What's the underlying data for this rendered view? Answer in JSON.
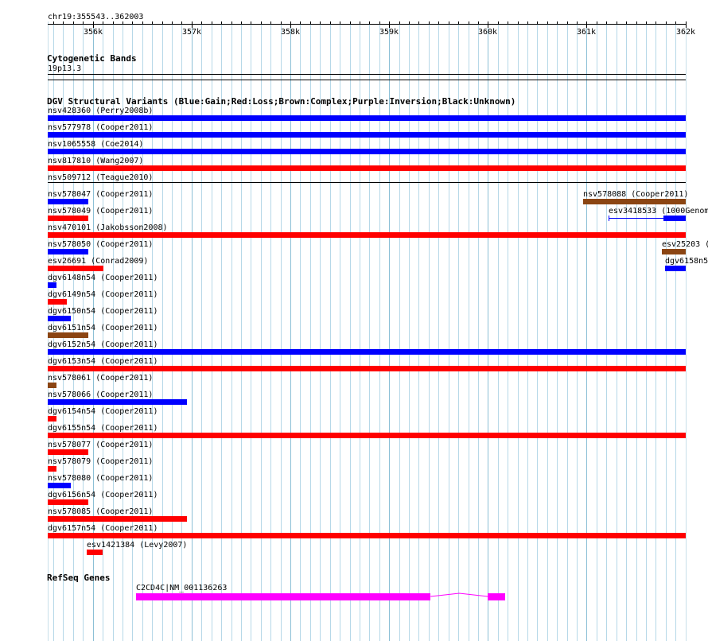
{
  "ruler": {
    "location": "chr19:355543..362003",
    "ticks": [
      "356k",
      "357k",
      "358k",
      "359k",
      "360k",
      "361k",
      "362k"
    ],
    "tick_positions_bp": [
      356000,
      357000,
      358000,
      359000,
      360000,
      361000,
      362000
    ]
  },
  "range": {
    "start": 355543,
    "end": 362003
  },
  "cytoband": {
    "title": "Cytogenetic Bands",
    "band": "19p13.3"
  },
  "dgv": {
    "title": "DGV Structural Variants (Blue:Gain;Red:Loss;Brown:Complex;Purple:Inversion;Black:Unknown)",
    "colors": {
      "gain": "#0000ff",
      "loss": "#ff0000",
      "complex": "#8b4513",
      "unknown": "#000000"
    },
    "features": [
      {
        "label": "nsv428360 (Perry2008b)",
        "type": "gain",
        "start": 355543,
        "end": 362003,
        "row": 0
      },
      {
        "label": "nsv577978 (Cooper2011)",
        "type": "gain",
        "start": 355543,
        "end": 362003,
        "row": 1
      },
      {
        "label": "nsv1065558 (Coe2014)",
        "type": "gain",
        "start": 355543,
        "end": 362003,
        "row": 2
      },
      {
        "label": "nsv817810 (Wang2007)",
        "type": "loss",
        "start": 355543,
        "end": 362003,
        "row": 3
      },
      {
        "label": "nsv509712 (Teague2010)",
        "type": "unknown",
        "start": 355543,
        "end": 362003,
        "row": 4,
        "thin": true
      },
      {
        "label": "nsv578047 (Cooper2011)",
        "type": "gain",
        "start": 355543,
        "end": 355950,
        "row": 5
      },
      {
        "label": "nsv578088 (Cooper2011)",
        "type": "complex",
        "start": 360960,
        "end": 362003,
        "row": 5
      },
      {
        "label": "nsv578049 (Cooper2011)",
        "type": "loss",
        "start": 355543,
        "end": 355950,
        "row": 6
      },
      {
        "label": "esv3418533 (1000Genom",
        "type": "gain",
        "start": 361220,
        "end": 362003,
        "row": 6,
        "esv": true
      },
      {
        "label": "nsv470101 (Jakobsson2008)",
        "type": "loss",
        "start": 355543,
        "end": 362003,
        "row": 7
      },
      {
        "label": "nsv578050 (Cooper2011)",
        "type": "gain",
        "start": 355543,
        "end": 355950,
        "row": 8
      },
      {
        "label": "esv25203 (",
        "type": "complex",
        "start": 361760,
        "end": 362003,
        "row": 8
      },
      {
        "label": "esv26691 (Conrad2009)",
        "type": "loss",
        "start": 355543,
        "end": 356110,
        "row": 9
      },
      {
        "label": "dgv6158n5",
        "type": "gain",
        "start": 361790,
        "end": 362003,
        "row": 9
      },
      {
        "label": "dgv6148n54 (Cooper2011)",
        "type": "gain",
        "start": 355543,
        "end": 355630,
        "row": 10
      },
      {
        "label": "dgv6149n54 (Cooper2011)",
        "type": "loss",
        "start": 355543,
        "end": 355740,
        "row": 11
      },
      {
        "label": "dgv6150n54 (Cooper2011)",
        "type": "gain",
        "start": 355543,
        "end": 355780,
        "row": 12
      },
      {
        "label": "dgv6151n54 (Cooper2011)",
        "type": "complex",
        "start": 355543,
        "end": 355950,
        "row": 13
      },
      {
        "label": "dgv6152n54 (Cooper2011)",
        "type": "gain",
        "start": 355543,
        "end": 362003,
        "row": 14
      },
      {
        "label": "dgv6153n54 (Cooper2011)",
        "type": "loss",
        "start": 355543,
        "end": 362003,
        "row": 15
      },
      {
        "label": "nsv578061 (Cooper2011)",
        "type": "complex",
        "start": 355543,
        "end": 355630,
        "row": 16
      },
      {
        "label": "nsv578066 (Cooper2011)",
        "type": "gain",
        "start": 355543,
        "end": 356950,
        "row": 17
      },
      {
        "label": "dgv6154n54 (Cooper2011)",
        "type": "loss",
        "start": 355543,
        "end": 355630,
        "row": 18
      },
      {
        "label": "dgv6155n54 (Cooper2011)",
        "type": "loss",
        "start": 355543,
        "end": 362003,
        "row": 19
      },
      {
        "label": "nsv578077 (Cooper2011)",
        "type": "loss",
        "start": 355543,
        "end": 355950,
        "row": 20
      },
      {
        "label": "nsv578079 (Cooper2011)",
        "type": "loss",
        "start": 355543,
        "end": 355630,
        "row": 21
      },
      {
        "label": "nsv578080 (Cooper2011)",
        "type": "gain",
        "start": 355543,
        "end": 355780,
        "row": 22
      },
      {
        "label": "dgv6156n54 (Cooper2011)",
        "type": "loss",
        "start": 355543,
        "end": 355950,
        "row": 23
      },
      {
        "label": "nsv578085 (Cooper2011)",
        "type": "loss",
        "start": 355543,
        "end": 356950,
        "row": 24
      },
      {
        "label": "dgv6157n54 (Cooper2011)",
        "type": "loss",
        "start": 355543,
        "end": 362003,
        "row": 25
      },
      {
        "label": "esv1421384 (Levy2007)",
        "type": "loss",
        "start": 355940,
        "end": 356100,
        "row": 26
      }
    ]
  },
  "refseq": {
    "title": "RefSeq Genes",
    "gene_label": "C2CD4C|NM_001136263",
    "exons": [
      {
        "start": 356440,
        "end": 359420
      },
      {
        "start": 360000,
        "end": 360180
      }
    ],
    "intron": {
      "start": 359420,
      "end": 360000
    },
    "color": "#ff00ff"
  }
}
